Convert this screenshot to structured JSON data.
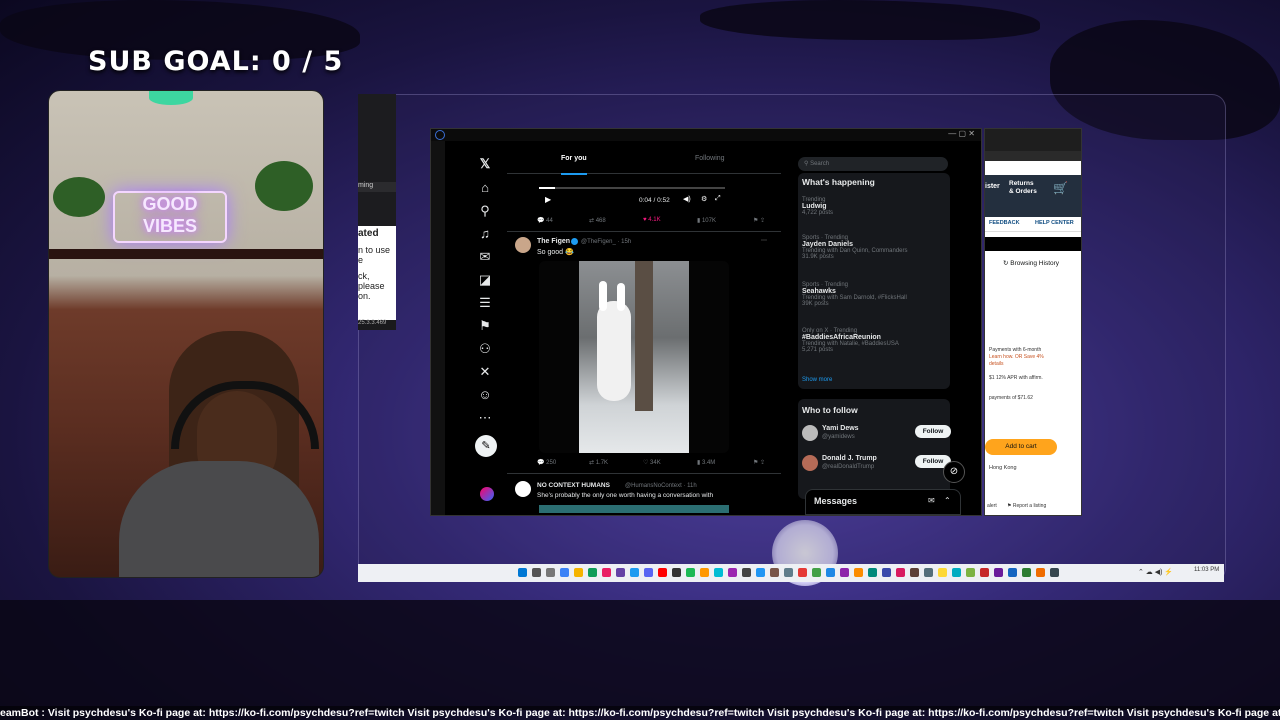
{
  "overlay": {
    "sub_goal": "SUB GOAL:  0 / 5",
    "ticker": "eamBot : Visit psychdesu's Ko-fi page at: https://ko-fi.com/psychdesu?ref=twitch  Visit psychdesu's Ko-fi page at: https://ko-fi.com/psychdesu?ref=twitch  Visit psychdesu's Ko-fi page at: https://ko-fi.com/psychdesu?ref=twitch  Visit psychdesu's Ko-fi page at: https://ko-fi.com/psychdesu?ref=twitch"
  },
  "webcam": {
    "neon_line1": "GOOD",
    "neon_line2": "VIBES"
  },
  "left_window": {
    "heading": "ated",
    "line1": "n to use",
    "line2": "e",
    "line3": "ck, please",
    "line4": "on.",
    "footer": "25.3.3.469",
    "tab": "ming"
  },
  "x": {
    "tabs": {
      "for_you": "For you",
      "following": "Following"
    },
    "video_time": "0:04 / 0:52",
    "post0_stats": {
      "replies": "44",
      "reposts": "468",
      "likes": "4.1K",
      "views": "107K"
    },
    "post1": {
      "name": "The Figen",
      "handle": "@TheFigen_ · 15h",
      "text": "So good 😂",
      "stats": {
        "replies": "250",
        "reposts": "1.7K",
        "likes": "34K",
        "views": "3.4M"
      }
    },
    "post2": {
      "name": "NO CONTEXT HUMANS",
      "handle": "@HumansNoContext · 11h",
      "text": "She's probably the only one worth having a conversation with"
    },
    "search_placeholder": "Search",
    "whats_happening": {
      "title": "What's happening",
      "trends": [
        {
          "context": "Trending",
          "name": "Ludwig",
          "extra": "4,722 posts"
        },
        {
          "context": "Sports · Trending",
          "name": "Jayden Daniels",
          "extra": "Trending with Dan Quinn, Commanders",
          "extra2": "31.9K posts"
        },
        {
          "context": "Sports · Trending",
          "name": "Seahawks",
          "extra": "Trending with Sam Darnold, #FlicksHall",
          "extra2": "39K posts"
        },
        {
          "context": "Only on X · Trending",
          "name": "#BaddiesAfricaReunion",
          "extra": "Trending with Natalie, #BaddiesUSA",
          "extra2": "5,271 posts"
        }
      ],
      "show_more": "Show more"
    },
    "who_to_follow": {
      "title": "Who to follow",
      "accounts": [
        {
          "name": "Yami Dews",
          "handle": "@yamidews",
          "button": "Follow"
        },
        {
          "name": "Donald J. Trump",
          "handle": "@realDonaldTrump",
          "button": "Follow"
        }
      ]
    },
    "messages": "Messages"
  },
  "amazon": {
    "returns": "Returns",
    "orders": "& Orders",
    "ister": "ister",
    "feedback": "FEEDBACK",
    "help_center": "HELP CENTER",
    "browsing_history": "Browsing History",
    "pay_line1": "Payments with 6-month",
    "pay_line2": "Learn how. OR Save 4%",
    "pay_line3": "details",
    "apr": "$1 12% APR with affirm.",
    "monthly": "payments of $71.62",
    "add_to_cart": "Add to cart",
    "hong_kong": "Hong Kong",
    "alert": "alert",
    "report": "Report a listing"
  },
  "taskbar": {
    "clock": "11:03 PM"
  },
  "colors": {
    "x_blue": "#1d9bf0",
    "amazon_navy": "#232f3e",
    "amazon_blue": "#0f4c81",
    "add_to_cart": "#ffa41c",
    "like_pink": "#f91880"
  }
}
